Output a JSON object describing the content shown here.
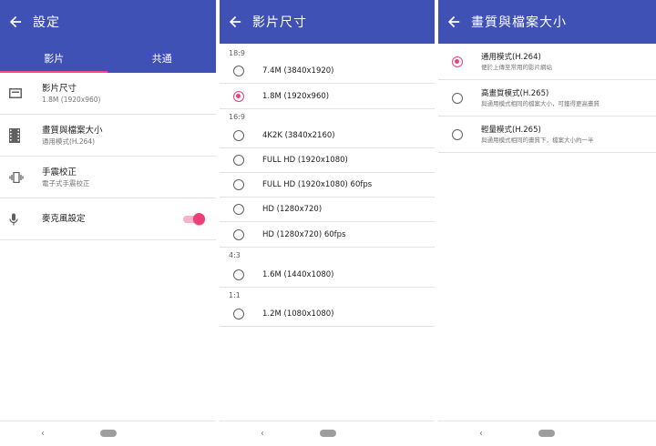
{
  "panel1": {
    "title": "設定",
    "tabs": [
      "影片",
      "共通"
    ],
    "settings": [
      {
        "icon": "screen-size-icon",
        "title": "影片尺寸",
        "subtitle": "1.8M (1920x960)"
      },
      {
        "icon": "film-icon",
        "title": "畫質與檔案大小",
        "subtitle": "通用模式(H.264)"
      },
      {
        "icon": "vibration-icon",
        "title": "手震校正",
        "subtitle": "電子式手震校正"
      },
      {
        "icon": "microphone-icon",
        "title": "麥克風設定",
        "subtitle": "",
        "toggle_on": true
      }
    ]
  },
  "panel2": {
    "title": "影片尺寸",
    "groups": [
      {
        "label": "18:9",
        "options": [
          {
            "label": "7.4M (3840x1920)",
            "selected": false
          },
          {
            "label": "1.8M (1920x960)",
            "selected": true
          }
        ]
      },
      {
        "label": "16:9",
        "options": [
          {
            "label": "4K2K (3840x2160)",
            "selected": false
          },
          {
            "label": "FULL HD (1920x1080)",
            "selected": false
          },
          {
            "label": "FULL HD (1920x1080) 60fps",
            "selected": false
          },
          {
            "label": "HD (1280x720)",
            "selected": false
          },
          {
            "label": "HD (1280x720) 60fps",
            "selected": false
          }
        ]
      },
      {
        "label": "4:3",
        "options": [
          {
            "label": "1.6M (1440x1080)",
            "selected": false
          }
        ]
      },
      {
        "label": "1:1",
        "options": [
          {
            "label": "1.2M (1080x1080)",
            "selected": false
          }
        ]
      }
    ]
  },
  "panel3": {
    "title": "畫質與檔案大小",
    "options": [
      {
        "title": "通用模式(H.264)",
        "subtitle": "便於上傳至常用的影片網站",
        "selected": true
      },
      {
        "title": "高畫質模式(H.265)",
        "subtitle": "與通用模式相同的檔案大小，可獲得更高畫質",
        "selected": false
      },
      {
        "title": "輕量模式(H.265)",
        "subtitle": "與通用模式相同的畫質下，檔案大小約一半",
        "selected": false
      }
    ]
  },
  "navbar": {
    "back_glyph": "‹"
  },
  "colors": {
    "appbar": "#3f51b5",
    "accent": "#ec407a",
    "indicator": "#ff4081"
  }
}
